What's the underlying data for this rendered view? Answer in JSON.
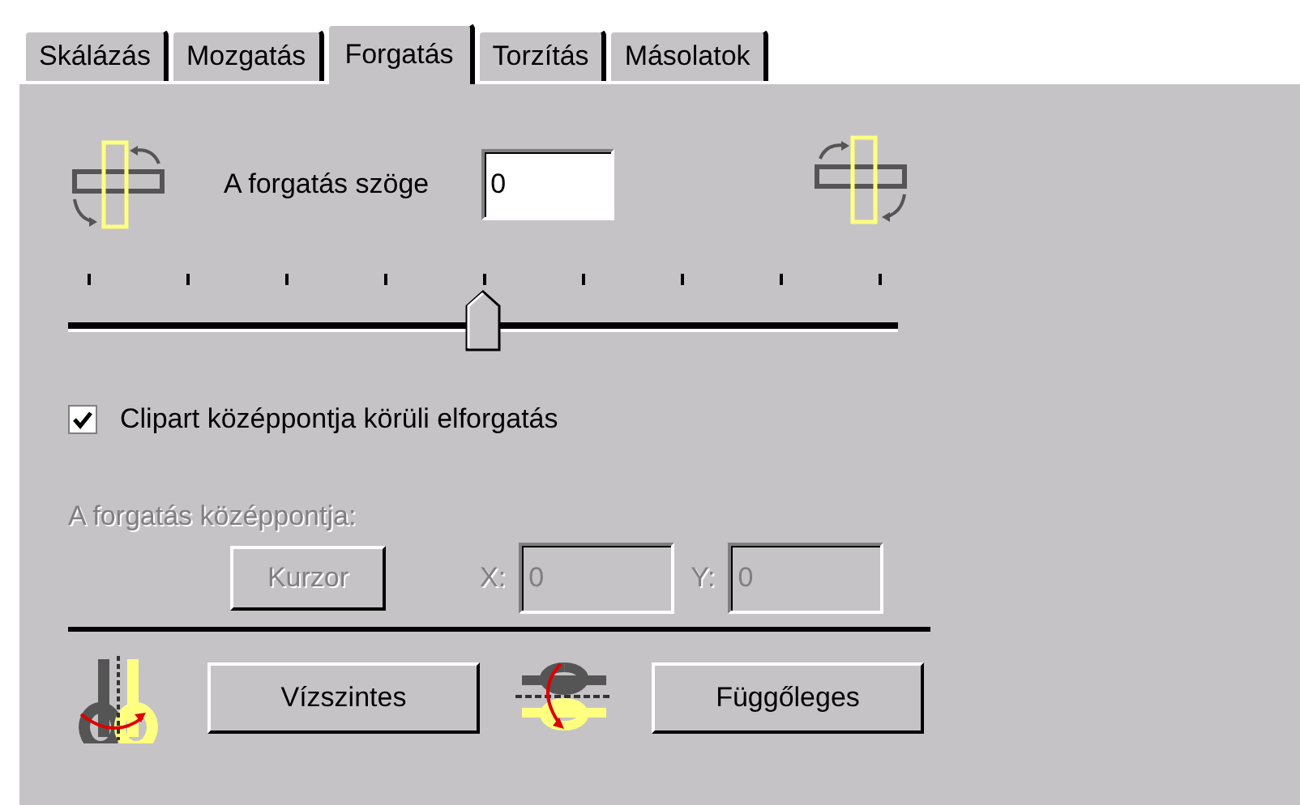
{
  "tabs": [
    {
      "label": "Skálázás",
      "selected": false
    },
    {
      "label": "Mozgatás",
      "selected": false
    },
    {
      "label": "Forgatás",
      "selected": true
    },
    {
      "label": "Torzítás",
      "selected": false
    },
    {
      "label": "Másolatok",
      "selected": false
    }
  ],
  "angle": {
    "label": "A forgatás szöge",
    "value": "0"
  },
  "slider": {
    "level": 0.5
  },
  "center_checkbox": {
    "label": "Clipart középpontja körüli elforgatás",
    "checked": true
  },
  "center": {
    "label": "A forgatás középpontja:",
    "disabled": true,
    "button": "Kurzor",
    "x_label": "X:",
    "x_value": "0",
    "y_label": "Y:",
    "y_value": "0"
  },
  "buttons": [
    "Vízszintes",
    "Függőleges"
  ]
}
